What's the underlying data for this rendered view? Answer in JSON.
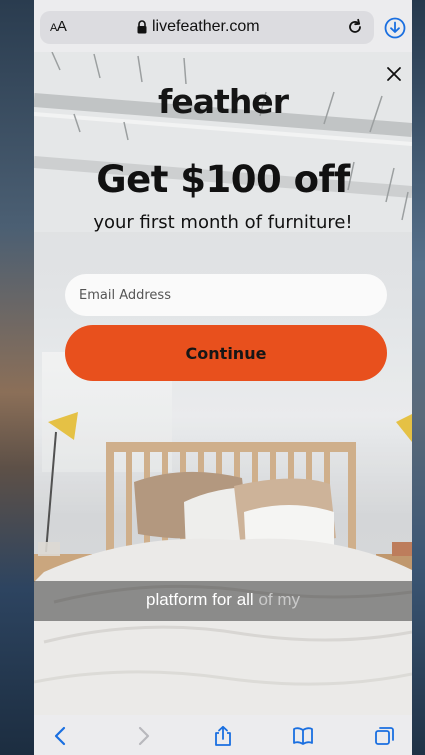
{
  "browser": {
    "text_size_label_small": "A",
    "text_size_label_large": "A",
    "domain": "livefeather.com"
  },
  "popup": {
    "logo_text": "feather",
    "headline": "Get $100 off",
    "subhead": "your first month of furniture!",
    "email_placeholder": "Email Address",
    "email_value": "",
    "continue_label": "Continue"
  },
  "caption": {
    "text_main": "platform for all",
    "text_dim": "of my"
  },
  "colors": {
    "cta": "#e8501d",
    "link_blue": "#1a6fe0"
  },
  "icons": {
    "lock": "lock-icon",
    "reload": "reload-icon",
    "download": "download-icon",
    "close": "close-icon",
    "back": "chevron-left-icon",
    "forward": "chevron-right-icon",
    "share": "share-icon",
    "bookmarks": "book-icon",
    "tabs": "tabs-icon"
  }
}
